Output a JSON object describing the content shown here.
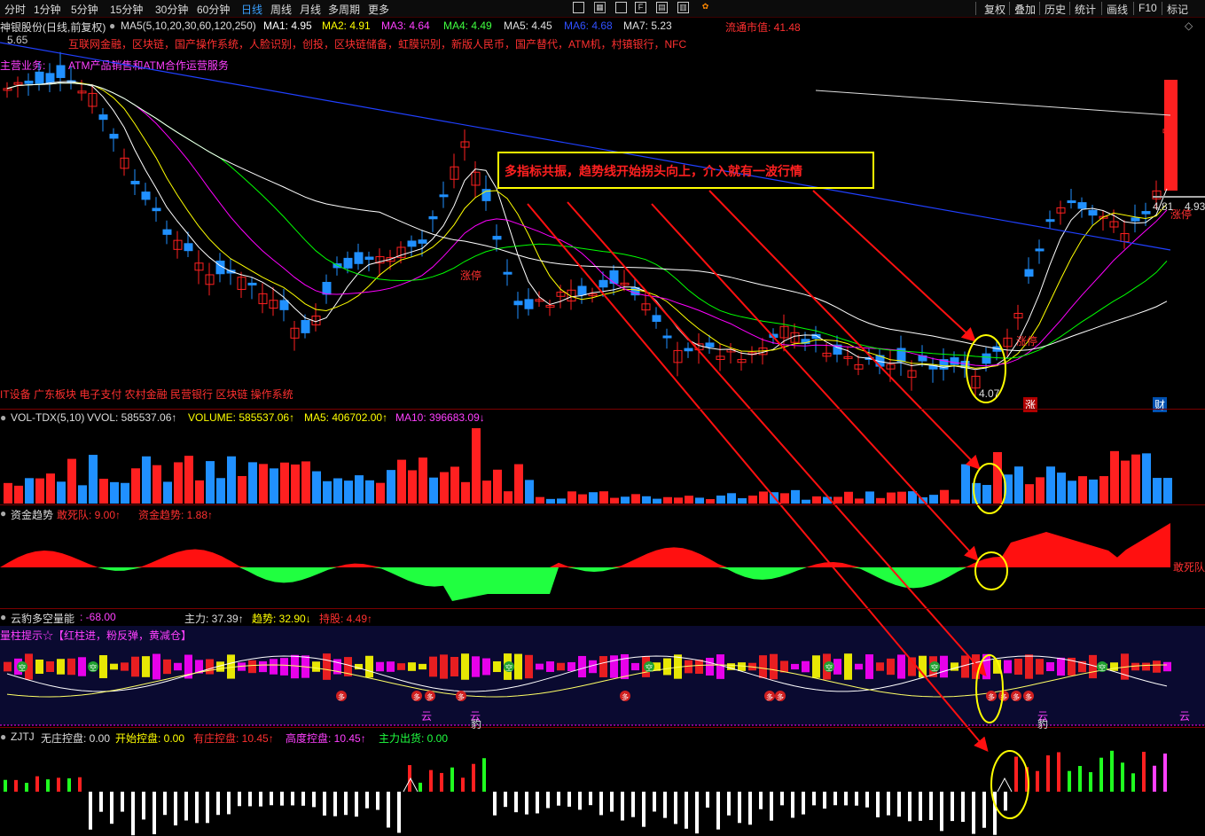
{
  "toolbar": {
    "periods": [
      "分时",
      "1分钟",
      "5分钟",
      "15分钟",
      "30分钟",
      "60分钟",
      "日线",
      "周线",
      "月线",
      "多周期",
      "更多"
    ],
    "active_period": "日线",
    "right_buttons": [
      "复权",
      "叠加",
      "历史",
      "统计",
      "画线",
      "F10",
      "标记"
    ]
  },
  "main_panel": {
    "stock_title": "神银股份(日线,前复权)",
    "ma_params": "MA5(5,10,20,30,60,120,250)",
    "ma_values": [
      {
        "label": "MA1: 4.95",
        "color": "#ffffff"
      },
      {
        "label": "MA2: 4.91",
        "color": "#ffff00"
      },
      {
        "label": "MA3: 4.64",
        "color": "#ff00ff"
      },
      {
        "label": "MA4: 4.49",
        "color": "#00ff00"
      },
      {
        "label": "MA5: 4.45",
        "color": "#e0e0e0"
      },
      {
        "label": "MA6: 4.68",
        "color": "#2040ff"
      },
      {
        "label": "MA7: 5.23",
        "color": "#e0e0e0"
      }
    ],
    "circulating_value": "流通市值: 41.48",
    "price_top": "5.65",
    "concept_line": "互联网金融，区块链，国产操作系统，人脸识别，创投，区块链储备，虹膜识别，新版人民币，国产替代，ATM机，村镇银行，NFC",
    "business_label": "主营业务:",
    "business_value": "ATM产品销售和ATM合作运营服务",
    "annotation": "多指标共振，趋势线开始拐头向上，介入就有一波行情",
    "limit_up_1": "涨停",
    "limit_up_2": "涨停",
    "limit_up_3": "涨停",
    "price_low": "4.07",
    "price_right": "4.93",
    "price_right2": "4.81",
    "sectors": "IT设备 广东板块 电子支付 农村金融 民营银行 区块链 操作系统",
    "marker_zhang": "涨",
    "marker_cai": "财"
  },
  "volume_panel": {
    "title": "VOL-TDX(5,10)",
    "vvol": "VVOL: 585537.06↑",
    "volume": "VOLUME: 585537.06↑",
    "ma5": "MA5: 406702.00↑",
    "ma10": "MA10: 396683.09↓"
  },
  "fund_panel": {
    "title": "资金趋势",
    "dare": "敢死队: 9.00↑",
    "trend": "资金趋势: 1.88↑",
    "right_label": "敢死队"
  },
  "yunbao_panel": {
    "title": "云豹多空量能",
    "value": ": -68.00",
    "main_force": "主力: 37.39↑",
    "trend": "趋势: 32.90↓",
    "holding": "持股: 4.49↑",
    "hint": "量柱提示☆【红柱进，粉反弹，黄减仓】",
    "cloud_labels": [
      "云",
      "云",
      "云",
      "云"
    ],
    "leopard_labels": [
      "豹",
      "豹"
    ],
    "duo": "多",
    "kong": "空"
  },
  "zjtj_panel": {
    "title": "ZJTJ",
    "no_control": "无庄控盘: 0.00",
    "start_control": "开始控盘: 0.00",
    "has_control": "有庄控盘: 10.45↑",
    "high_control": "高度控盘: 10.45↑",
    "ship_out": "主力出货: 0.00"
  },
  "colors": {
    "up": "#ff2020",
    "down": "#2090ff",
    "annotation_border": "#ffff00",
    "annotation_text": "#ff2020",
    "fund_up": "#ff1010",
    "fund_down": "#20ff40"
  }
}
